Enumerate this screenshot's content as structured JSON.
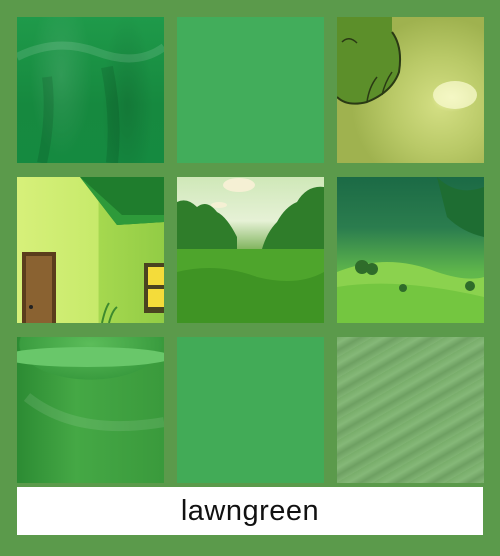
{
  "caption": {
    "text": "lawngreen"
  },
  "tiles": [
    {
      "subject": "green-fabric-drape"
    },
    {
      "subject": "flat-green-swatch"
    },
    {
      "subject": "cartoon-green-paw"
    },
    {
      "subject": "cartoon-green-house"
    },
    {
      "subject": "grass-meadow-with-trees"
    },
    {
      "subject": "green-rolling-hills"
    },
    {
      "subject": "green-ceramic-cup"
    },
    {
      "subject": "flat-green-swatch"
    },
    {
      "subject": "green-brushed-texture"
    }
  ],
  "colors": {
    "background": "#5b9a4b",
    "caption_bg": "#ffffff",
    "caption_text": "#111111"
  }
}
